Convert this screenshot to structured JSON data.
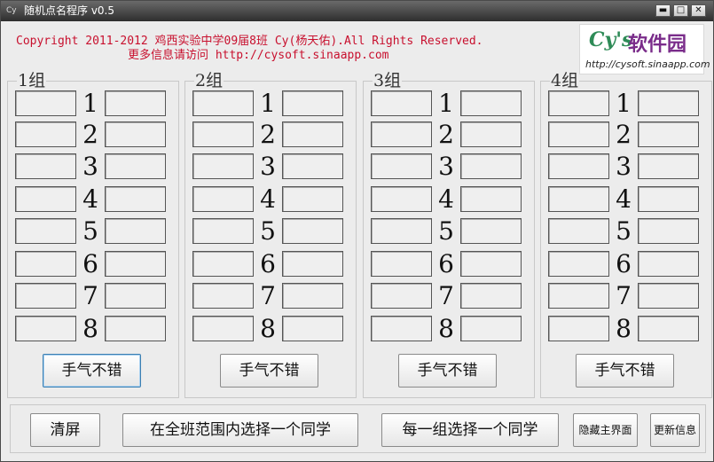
{
  "window": {
    "title": "随机点名程序 v0.5",
    "app_icon": "Cy",
    "controls": {
      "minimize": "▬",
      "maximize": "□",
      "close": "✕"
    }
  },
  "header": {
    "copyright": "Copyright 2011-2012 鸡西实验中学09届8班 Cy(杨天佑).All Rights Reserved.",
    "more_info": "更多信息请访问 http://cysoft.sinaapp.com",
    "logo": {
      "cy": "Cy's",
      "cn": "软件园",
      "url": "http://cysoft.sinaapp.com"
    }
  },
  "groups": [
    {
      "label": "1组",
      "numbers": [
        "1",
        "2",
        "3",
        "4",
        "5",
        "6",
        "7",
        "8"
      ],
      "lucky_button": "手气不错"
    },
    {
      "label": "2组",
      "numbers": [
        "1",
        "2",
        "3",
        "4",
        "5",
        "6",
        "7",
        "8"
      ],
      "lucky_button": "手气不错"
    },
    {
      "label": "3组",
      "numbers": [
        "1",
        "2",
        "3",
        "4",
        "5",
        "6",
        "7",
        "8"
      ],
      "lucky_button": "手气不错"
    },
    {
      "label": "4组",
      "numbers": [
        "1",
        "2",
        "3",
        "4",
        "5",
        "6",
        "7",
        "8"
      ],
      "lucky_button": "手气不错"
    }
  ],
  "bottom_bar": {
    "clear": "清屏",
    "pick_class": "在全班范围内选择一个同学",
    "pick_each_group": "每一组选择一个同学",
    "hide_main": "隐藏主界面",
    "update": "更新信息"
  },
  "colors": {
    "accent_red": "#c8102e",
    "titlebar": "#3a3a3a",
    "background": "#ececec"
  }
}
